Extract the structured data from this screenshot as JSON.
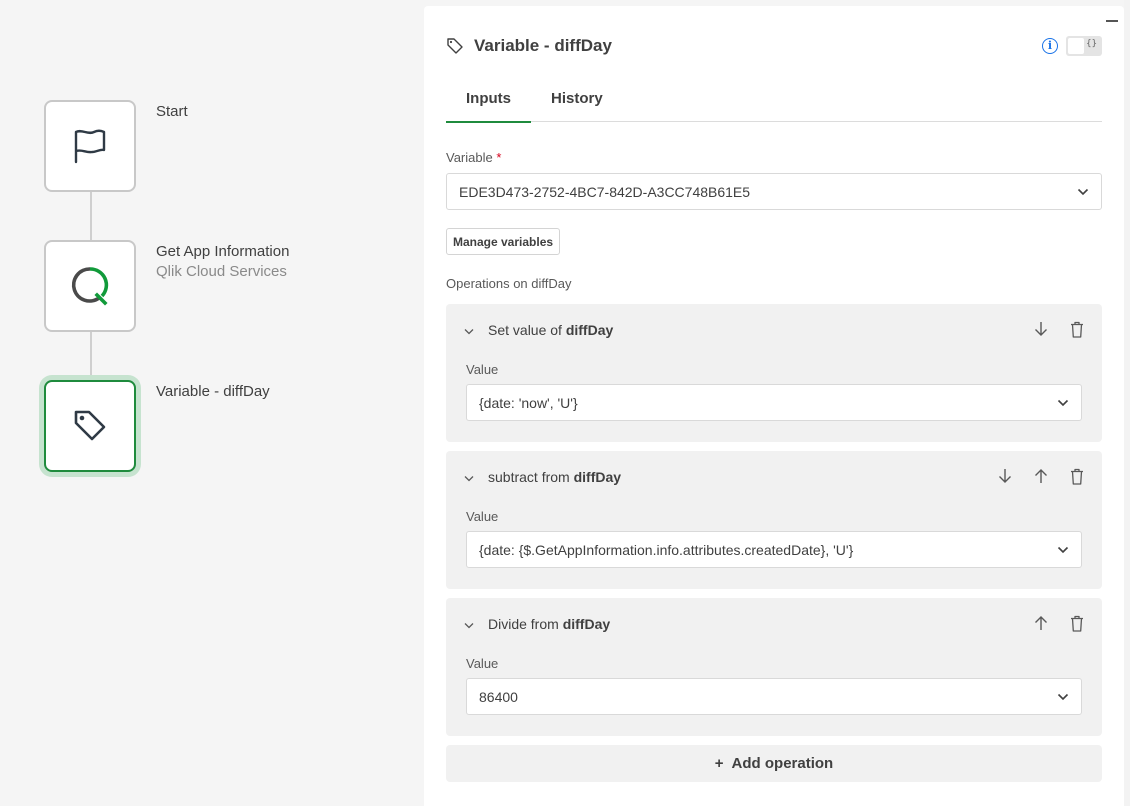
{
  "flow": {
    "nodes": [
      {
        "label": "Start",
        "sublabel": "",
        "icon": "flag-icon"
      },
      {
        "label": "Get App Information",
        "sublabel": "Qlik Cloud Services",
        "icon": "qlik-logo-icon"
      },
      {
        "label": "Variable - diffDay",
        "sublabel": "",
        "icon": "tag-icon",
        "selected": true
      }
    ]
  },
  "panel": {
    "title": "Variable - diffDay",
    "json_toggle_label": "{}",
    "info_glyph": "i",
    "tabs": [
      {
        "label": "Inputs",
        "active": true
      },
      {
        "label": "History",
        "active": false
      }
    ],
    "variable": {
      "label": "Variable",
      "required_mark": "*",
      "value": "EDE3D473-2752-4BC7-842D-A3CC748B61E5"
    },
    "manage_variables_label": "Manage variables",
    "operations_label": "Operations on diffDay",
    "operations": [
      {
        "prefix": "Set value of",
        "target": "diffDay",
        "value_label": "Value",
        "value": "{date: 'now', 'U'}",
        "actions": [
          "move-down",
          "delete"
        ]
      },
      {
        "prefix": "subtract from",
        "target": "diffDay",
        "value_label": "Value",
        "value": "{date: {$.GetAppInformation.info.attributes.createdDate}, 'U'}",
        "actions": [
          "move-down",
          "move-up",
          "delete"
        ]
      },
      {
        "prefix": "Divide from",
        "target": "diffDay",
        "value_label": "Value",
        "value": "86400",
        "actions": [
          "move-up",
          "delete"
        ]
      }
    ],
    "add_operation_label": "Add operation",
    "add_operation_glyph": "+"
  },
  "colors": {
    "accent_green": "#1f8b3d",
    "selected_glow": "#c6e3cf",
    "info_blue": "#1a73e8",
    "required_red": "#d6001c",
    "card_bg": "#f1f1f1",
    "canvas_bg": "#f5f5f5"
  }
}
